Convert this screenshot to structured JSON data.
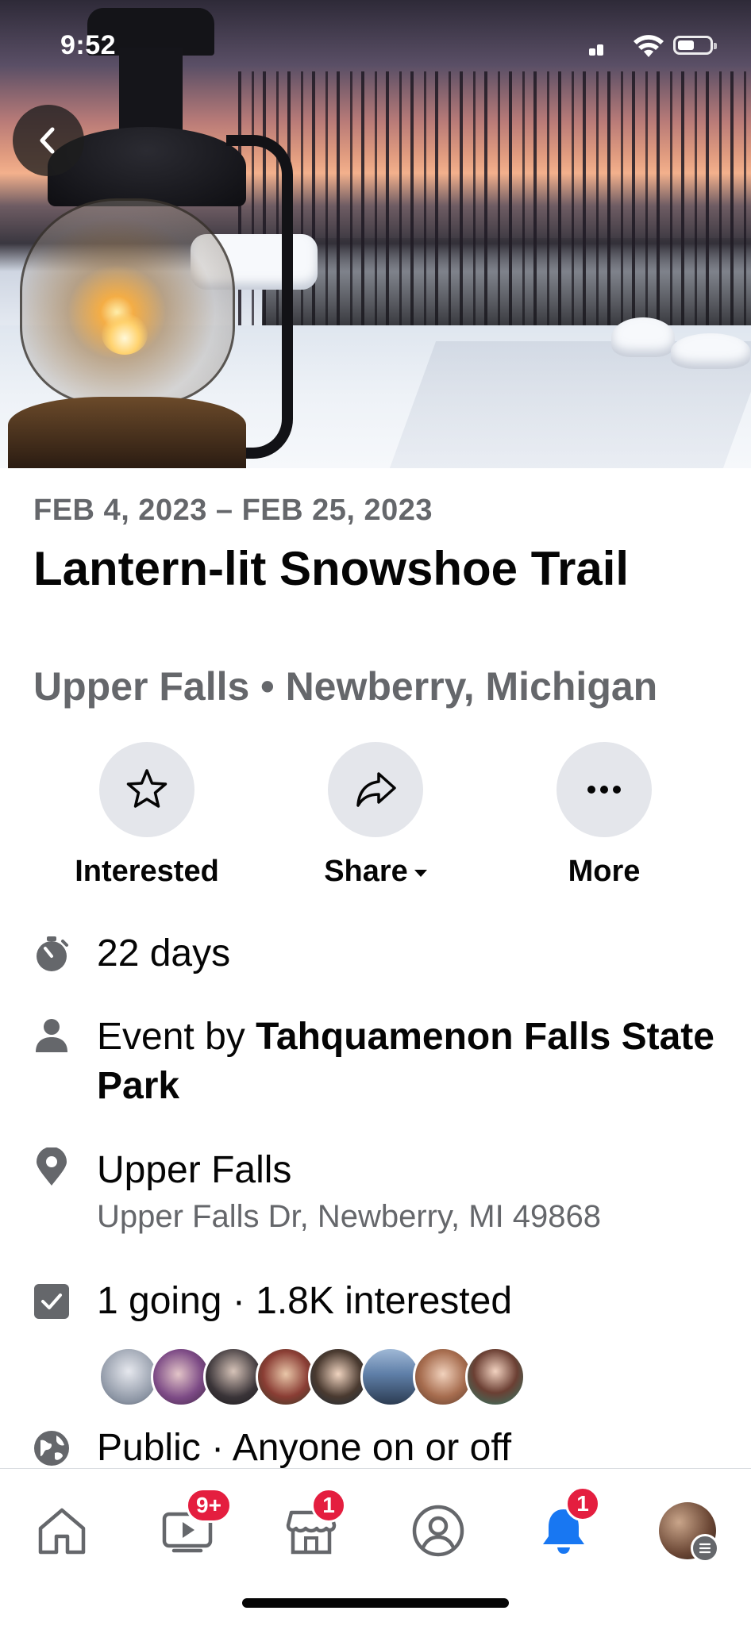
{
  "status_bar": {
    "time": "9:52"
  },
  "event": {
    "date_range": "FEB 4, 2023 – FEB 25, 2023",
    "title": "Lantern-lit Snowshoe Trail",
    "subtitle": "Upper Falls • Newberry, Michigan"
  },
  "actions": [
    {
      "label": "Interested",
      "icon": "star-icon"
    },
    {
      "label": "Share",
      "icon": "share-arrow-icon"
    },
    {
      "label": "More",
      "icon": "more-dots-icon"
    }
  ],
  "details": {
    "duration": "22 days",
    "host_prefix": "Event by ",
    "host_name": "Tahquamenon Falls State Park",
    "location_name": "Upper Falls",
    "location_address": "Upper Falls Dr, Newberry, MI 49868",
    "attendance": "1 going · 1.8K interested",
    "privacy": "Public · Anyone on or off"
  },
  "nav": {
    "watch_badge": "9+",
    "marketplace_badge": "1",
    "notifications_badge": "1"
  },
  "colors": {
    "accent": "#1877f2",
    "badge": "#e41e3f",
    "secondary_text": "#65676b",
    "button_bg": "#e4e6eb"
  }
}
